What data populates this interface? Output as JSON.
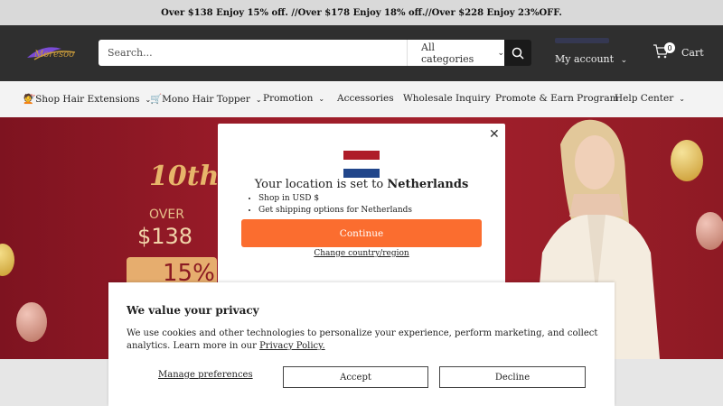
{
  "announcement": "Over $138 Enjoy 15% off. //Over $178 Enjoy 18% off.//Over $228 Enjoy 23%OFF.",
  "header": {
    "logo_text": "Moresoo",
    "search_placeholder": "Search...",
    "category_select": "All categories",
    "account_label": "My account",
    "cart_count": "0",
    "cart_label": "Cart"
  },
  "nav": {
    "items": [
      {
        "label": "💇Shop Hair Extensions"
      },
      {
        "label": "🛒Mono Hair Topper"
      },
      {
        "label": "Promotion"
      },
      {
        "label": "Accessories"
      },
      {
        "label": "Wholesale Inquiry"
      },
      {
        "label": "Promote & Earn Program"
      },
      {
        "label": "Help Center"
      }
    ]
  },
  "hero": {
    "headline": "10th",
    "over": "OVER",
    "amount": "$138",
    "percent": "15%"
  },
  "location_modal": {
    "title_prefix": "Your location is set to ",
    "country": "Netherlands",
    "bullets": [
      "Shop in USD $",
      "Get shipping options for Netherlands"
    ],
    "continue_label": "Continue",
    "change_label": "Change country/region",
    "flag_colors": [
      "#ae1c28",
      "#ffffff",
      "#21468b"
    ]
  },
  "privacy": {
    "title": "We value your privacy",
    "text": "We use cookies and other technologies to personalize your experience, perform marketing, and collect analytics. Learn more in our ",
    "policy_link": "Privacy Policy.",
    "manage_label": "Manage preferences",
    "accept_label": "Accept",
    "decline_label": "Decline"
  },
  "colors": {
    "accent": "#fb6d2f",
    "header_bg": "#2f2f2f",
    "hero_bg": "#9b1c29"
  }
}
